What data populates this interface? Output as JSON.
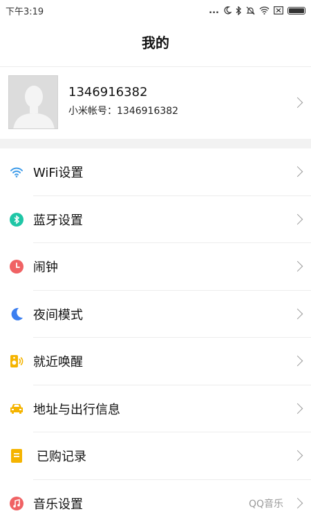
{
  "status_bar": {
    "time": "下午3:19",
    "dots": "...",
    "icons": [
      "moon-icon",
      "bluetooth-icon",
      "mute-icon",
      "wifi-icon",
      "sim-off-icon",
      "battery-icon"
    ]
  },
  "header": {
    "title": "我的"
  },
  "profile": {
    "name": "1346916382",
    "account_line": "小米帐号：1346916382"
  },
  "menu": {
    "items": [
      {
        "label": "WiFi设置",
        "icon": "wifi-icon",
        "color": "#3d9be9"
      },
      {
        "label": "蓝牙设置",
        "icon": "bluetooth-icon",
        "color": "#1fc6a6"
      },
      {
        "label": "闹钟",
        "icon": "clock-icon",
        "color": "#f06264"
      },
      {
        "label": "夜间模式",
        "icon": "moon-icon",
        "color": "#3c7ff0"
      },
      {
        "label": "就近唤醒",
        "icon": "speaker-icon",
        "color": "#f5b400"
      },
      {
        "label": "地址与出行信息",
        "icon": "car-icon",
        "color": "#f5b400"
      },
      {
        "label": "已购记录",
        "icon": "receipt-icon",
        "color": "#f5b400"
      },
      {
        "label": "音乐设置",
        "icon": "music-icon",
        "color": "#f06264",
        "value": "QQ音乐"
      }
    ]
  }
}
